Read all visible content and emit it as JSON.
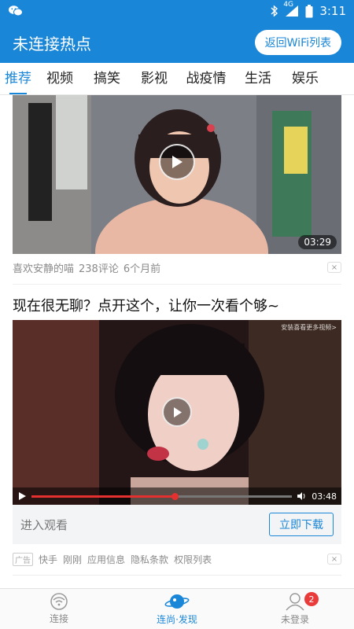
{
  "status_bar": {
    "network": "4G",
    "time": "3:11",
    "icons": [
      "wechat-icon",
      "bluetooth-icon",
      "signal-icon",
      "battery-icon"
    ]
  },
  "header": {
    "title": "未连接热点",
    "back_button": "返回WiFi列表"
  },
  "tabs": [
    {
      "label": "推荐",
      "active": true
    },
    {
      "label": "视频"
    },
    {
      "label": "搞笑"
    },
    {
      "label": "影视"
    },
    {
      "label": "战疫情"
    },
    {
      "label": "生活"
    },
    {
      "label": "娱乐"
    }
  ],
  "feed": {
    "item1": {
      "duration": "03:29",
      "author": "喜欢安静的喵",
      "comments": "238评论",
      "time": "6个月前",
      "dismiss": "×"
    },
    "ad": {
      "title": "现在很无聊？点开这个，让你一次看个够~",
      "watermark": "安装喜看更多视频>",
      "player_time": "03:48",
      "progress": 0.55,
      "cta_label": "进入观看",
      "download_label": "立即下载",
      "badge": "广告",
      "advertiser": "快手",
      "posted": "刚刚",
      "links": [
        "应用信息",
        "隐私条款",
        "权限列表"
      ],
      "dismiss": "×"
    }
  },
  "bottom_nav": {
    "items": [
      {
        "label": "连接",
        "icon": "wifi-icon"
      },
      {
        "label": "连尚·发现",
        "icon": "planet-icon",
        "active": true
      },
      {
        "label": "未登录",
        "icon": "user-icon",
        "badge": "2"
      }
    ]
  },
  "colors": {
    "primary": "#1a86d8",
    "badge_red": "#ea3b3b",
    "progress_red": "#e53030"
  }
}
